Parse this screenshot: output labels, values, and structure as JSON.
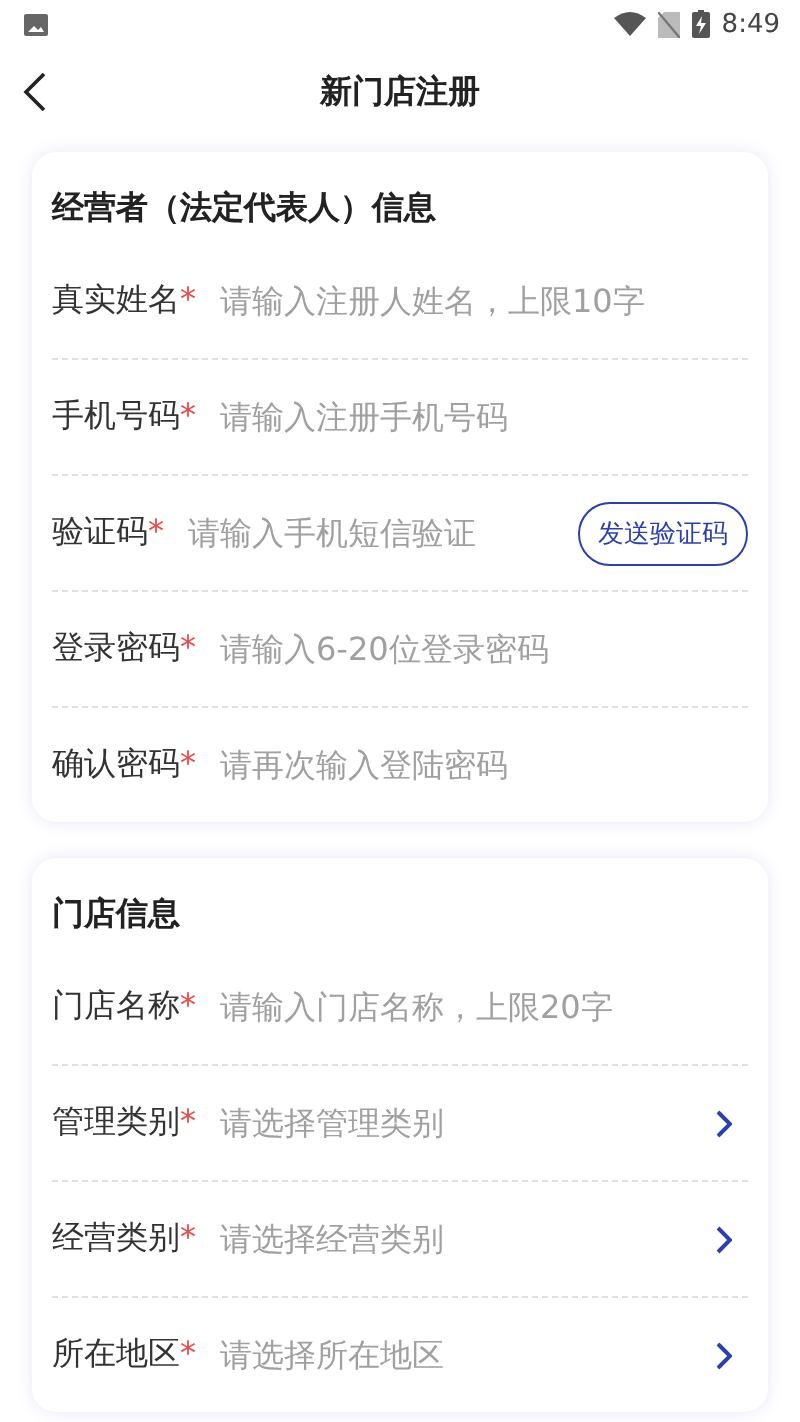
{
  "status_bar": {
    "time": "8:49"
  },
  "header": {
    "title": "新门店注册"
  },
  "sections": [
    {
      "title": "经营者（法定代表人）信息",
      "fields": [
        {
          "kind": "text",
          "label": "真实姓名",
          "mark": "*",
          "placeholder": "请输入注册人姓名，上限10字"
        },
        {
          "kind": "text",
          "label": "手机号码",
          "mark": "*",
          "placeholder": "请输入注册手机号码"
        },
        {
          "kind": "code",
          "label": "验证码",
          "mark": "*",
          "placeholder": "请输入手机短信验证",
          "button": "发送验证码"
        },
        {
          "kind": "text",
          "label": "登录密码",
          "mark": "*",
          "placeholder": "请输入6-20位登录密码"
        },
        {
          "kind": "text",
          "label": "确认密码",
          "mark": "*",
          "placeholder": "请再次输入登陆密码"
        }
      ]
    },
    {
      "title": "门店信息",
      "fields": [
        {
          "kind": "text",
          "label": "门店名称",
          "mark": "*",
          "placeholder": "请输入门店名称，上限20字"
        },
        {
          "kind": "select",
          "label": "管理类别",
          "mark": "*",
          "placeholder": "请选择管理类别"
        },
        {
          "kind": "select",
          "label": "经营类别",
          "mark": "*",
          "placeholder": "请选择经营类别"
        },
        {
          "kind": "select",
          "label": "所在地区",
          "mark": "*",
          "placeholder": "请选择所在地区"
        }
      ]
    }
  ]
}
